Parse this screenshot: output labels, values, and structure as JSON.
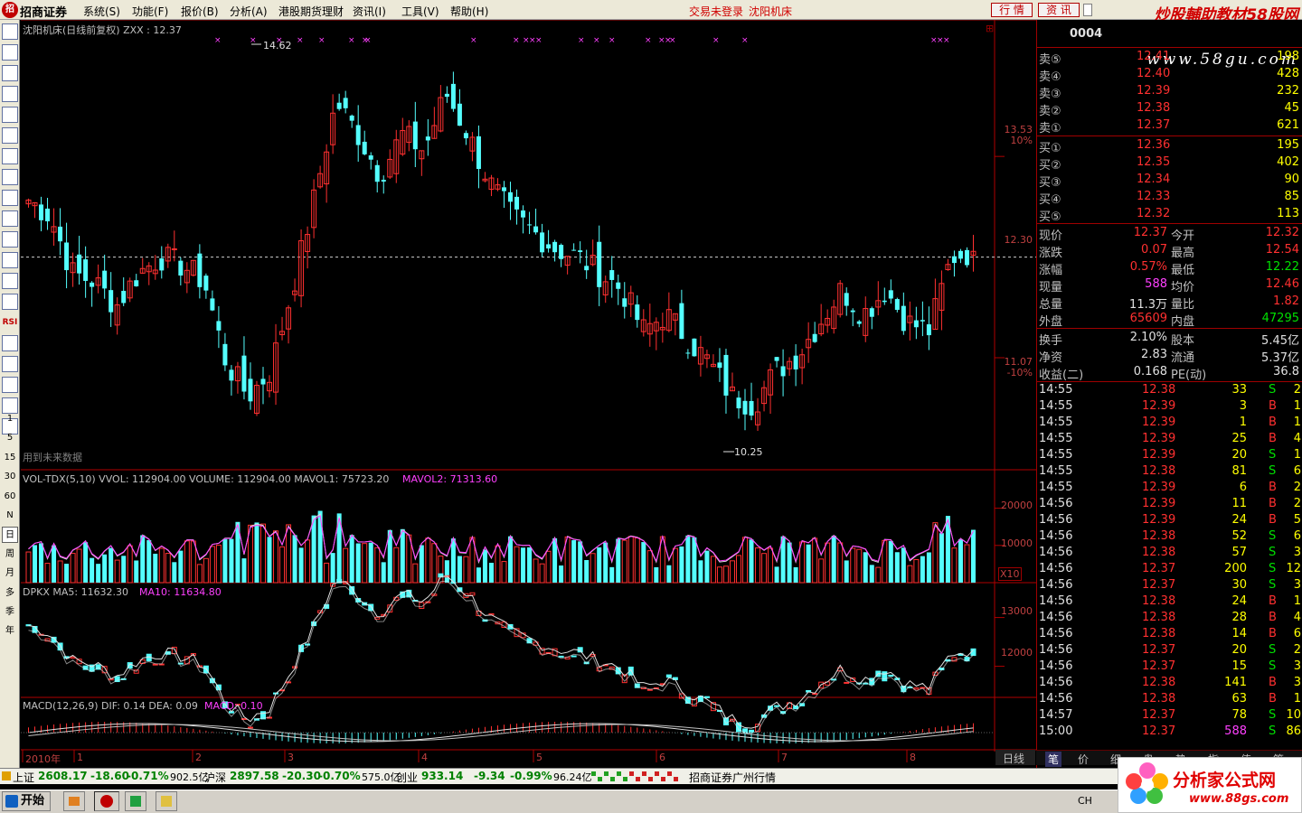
{
  "menu": {
    "logo": "招",
    "brand": "招商证券",
    "items": [
      "系统(S)",
      "功能(F)",
      "报价(B)",
      "分析(A)",
      "港股期货理财",
      "资讯(I)",
      "工具(V)",
      "帮助(H)"
    ],
    "status": "交易未登录",
    "stock_name": "沈阳机床",
    "btn_quote": "行 情",
    "btn_info": "资 讯",
    "watermark1": "炒股輔助教材58股网",
    "watermark2": "www.58gu.com"
  },
  "lefttool": {
    "items": [
      "1",
      "5",
      "15",
      "30",
      "60",
      "N",
      "日",
      "周",
      "月",
      "多",
      "季",
      "年"
    ],
    "icons": [
      "grid-icon",
      "list-icon",
      "line-chart-icon",
      "bar-chart-icon",
      "kline-icon",
      "table-icon",
      "f10-icon",
      "note-icon",
      "window-icon",
      "pen-icon",
      "fz-icon",
      "fm-icon",
      "zoom-icon",
      "ruler-icon",
      "rsi-icon",
      "dollar-icon",
      "move-icon",
      "arrow-icon",
      "pencil-icon",
      "fs-icon"
    ],
    "rsi": "RSI"
  },
  "main": {
    "title": "沈阳机床(日线前复权) ZXX : 12.37",
    "high_label": "14.62",
    "low_label": "10.25",
    "future_note": "用到未来数据",
    "axis": [
      "13.53",
      "10%",
      "12.30",
      "11.07",
      "-10%"
    ],
    "corner": "⊞"
  },
  "vol": {
    "title_a": "VOL-TDX(5,10)  VVOL: 112904.00  VOLUME: 112904.00  MAVOL1: 75723.20",
    "title_b": "MAVOL2: 71313.60",
    "axis": [
      "20000",
      "10000"
    ],
    "scale": "X10"
  },
  "dpkx": {
    "title_a": "DPKX    MA5: 11632.30",
    "title_b": "MA10: 11634.80",
    "axis": [
      "13000",
      "12000"
    ]
  },
  "macd": {
    "title_a": "MACD(12,26,9)  DIF: 0.14  DEA: 0.09",
    "title_b": "MACD: 0.10"
  },
  "xaxis": [
    "2010年",
    "1",
    "2",
    "3",
    "4",
    "5",
    "6",
    "7",
    "8"
  ],
  "bottom_tab": "日线",
  "quote": {
    "code": "0004",
    "asks": [
      {
        "label": "卖⑤",
        "price": "12.41",
        "vol": "198"
      },
      {
        "label": "卖④",
        "price": "12.40",
        "vol": "428"
      },
      {
        "label": "卖③",
        "price": "12.39",
        "vol": "232"
      },
      {
        "label": "卖②",
        "price": "12.38",
        "vol": "45"
      },
      {
        "label": "卖①",
        "price": "12.37",
        "vol": "621"
      }
    ],
    "bids": [
      {
        "label": "买①",
        "price": "12.36",
        "vol": "195"
      },
      {
        "label": "买②",
        "price": "12.35",
        "vol": "402"
      },
      {
        "label": "买③",
        "price": "12.34",
        "vol": "90"
      },
      {
        "label": "买④",
        "price": "12.33",
        "vol": "85"
      },
      {
        "label": "买⑤",
        "price": "12.32",
        "vol": "113"
      }
    ],
    "stats": [
      [
        "现价",
        "12.37",
        "今开",
        "12.32"
      ],
      [
        "涨跌",
        "0.07",
        "最高",
        "12.54"
      ],
      [
        "涨幅",
        "0.57%",
        "最低",
        "12.22"
      ],
      [
        "现量",
        "588",
        "均价",
        "12.46"
      ],
      [
        "总量",
        "11.3万",
        "量比",
        "1.82"
      ],
      [
        "外盘",
        "65609",
        "内盘",
        "47295"
      ]
    ],
    "fin": [
      [
        "换手",
        "2.10%",
        "股本",
        "5.45亿"
      ],
      [
        "净资",
        "2.83",
        "流通",
        "5.37亿"
      ],
      [
        "收益(二)",
        "0.168",
        "PE(动)",
        "36.8"
      ]
    ],
    "ticks": [
      [
        "14:55",
        "12.38",
        "33",
        "S",
        "2"
      ],
      [
        "14:55",
        "12.39",
        "3",
        "B",
        "1"
      ],
      [
        "14:55",
        "12.39",
        "1",
        "B",
        "1"
      ],
      [
        "14:55",
        "12.39",
        "25",
        "B",
        "4"
      ],
      [
        "14:55",
        "12.39",
        "20",
        "S",
        "1"
      ],
      [
        "14:55",
        "12.38",
        "81",
        "S",
        "6"
      ],
      [
        "14:55",
        "12.39",
        "6",
        "B",
        "2"
      ],
      [
        "14:56",
        "12.39",
        "11",
        "B",
        "2"
      ],
      [
        "14:56",
        "12.39",
        "24",
        "B",
        "5"
      ],
      [
        "14:56",
        "12.38",
        "52",
        "S",
        "6"
      ],
      [
        "14:56",
        "12.38",
        "57",
        "S",
        "3"
      ],
      [
        "14:56",
        "12.37",
        "200",
        "S",
        "12"
      ],
      [
        "14:56",
        "12.37",
        "30",
        "S",
        "3"
      ],
      [
        "14:56",
        "12.38",
        "24",
        "B",
        "1"
      ],
      [
        "14:56",
        "12.38",
        "28",
        "B",
        "4"
      ],
      [
        "14:56",
        "12.38",
        "14",
        "B",
        "6"
      ],
      [
        "14:56",
        "12.37",
        "20",
        "S",
        "2"
      ],
      [
        "14:56",
        "12.37",
        "15",
        "S",
        "3"
      ],
      [
        "14:56",
        "12.38",
        "141",
        "B",
        "3"
      ],
      [
        "14:56",
        "12.38",
        "63",
        "B",
        "1"
      ],
      [
        "14:57",
        "12.37",
        "78",
        "S",
        "10"
      ],
      [
        "15:00",
        "12.37",
        "588",
        "S",
        "86"
      ]
    ],
    "tabs": [
      "笔",
      "价",
      "细",
      "盘",
      "势",
      "指",
      "值",
      "筹"
    ]
  },
  "indexbar": [
    {
      "name": "上证",
      "val": "2608.17",
      "chg": "-18.60",
      "pct": "-0.71%",
      "amt": "902.5亿"
    },
    {
      "name": "沪深",
      "val": "2897.58",
      "chg": "-20.30",
      "pct": "-0.70%",
      "amt": "575.0亿"
    },
    {
      "name": "创业",
      "val": "933.14",
      "chg": "-9.34",
      "pct": "-0.99%",
      "amt": "96.24亿"
    }
  ],
  "indexbar_source": "招商证券广州行情",
  "taskbar": {
    "start": "开始",
    "tray": "CH"
  },
  "ad": {
    "text": "分析家公式网",
    "url": "www.88gs.com"
  },
  "colors": {
    "up": "#ff3030",
    "down": "#54ffff",
    "bg": "#000000",
    "axis": "#b00000",
    "magenta": "#ff40ff",
    "white": "#e0e0e0"
  },
  "chart_data": [
    {
      "type": "candlestick",
      "title": "沈阳机床(日线前复权)",
      "last": 12.37,
      "high": 14.62,
      "low": 10.25,
      "ylim": [
        9.9,
        15.0
      ],
      "x_ticks": [
        "2010年",
        "1",
        "2",
        "3",
        "4",
        "5",
        "6",
        "7",
        "8"
      ],
      "close_path": [
        13.0,
        12.8,
        12.1,
        12.0,
        11.7,
        12.1,
        12.3,
        12.2,
        12.0,
        11.0,
        10.6,
        10.9,
        11.9,
        13.0,
        14.2,
        13.8,
        13.3,
        13.8,
        13.6,
        14.3,
        13.8,
        13.2,
        12.8,
        12.6,
        12.4,
        12.3,
        12.1,
        11.9,
        11.4,
        11.6,
        11.3,
        11.0,
        10.6,
        10.5,
        10.9,
        11.1,
        11.5,
        11.9,
        11.6,
        11.9,
        11.5,
        11.4,
        12.3,
        12.37
      ]
    },
    {
      "type": "bar",
      "title": "VOL-TDX(5,10)",
      "volume": 112904.0,
      "mavol1": 75723.2,
      "mavol2": 71313.6,
      "ylim": [
        0,
        25000
      ]
    },
    {
      "type": "line",
      "title": "DPKX",
      "ma5": 11632.3,
      "ma10": 11634.8,
      "ylim": [
        11400,
        13400
      ]
    },
    {
      "type": "bar",
      "title": "MACD(12,26,9)",
      "dif": 0.14,
      "dea": 0.09,
      "macd": 0.1
    }
  ]
}
